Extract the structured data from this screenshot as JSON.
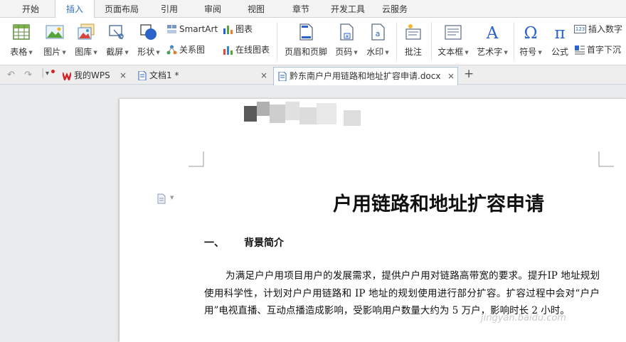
{
  "menu": {
    "items": [
      {
        "label": "开始"
      },
      {
        "label": "插入"
      },
      {
        "label": "页面布局"
      },
      {
        "label": "引用"
      },
      {
        "label": "审阅"
      },
      {
        "label": "视图"
      },
      {
        "label": "章节"
      },
      {
        "label": "开发工具"
      },
      {
        "label": "云服务"
      }
    ],
    "active": "插入"
  },
  "ribbon": {
    "table": "表格",
    "picture": "图片",
    "gallery": "图库",
    "screenshot": "截屏",
    "shape": "形状",
    "smartart": "SmartArt",
    "relation": "关系图",
    "chart": "图表",
    "online_chart": "在线图表",
    "header_footer": "页眉和页脚",
    "page_number": "页码",
    "watermark": "水印",
    "comment": "批注",
    "textbox": "文本框",
    "wordart": "艺术字",
    "symbol": "符号",
    "formula": "公式",
    "insert_number": "插入数字",
    "drop_cap": "首字下沉",
    "insert_number_badge": "123"
  },
  "tabs": [
    {
      "label": "我的WPS"
    },
    {
      "label": "文档1 *"
    },
    {
      "label": "黔东南户户用链路和地址扩容申请.docx"
    }
  ],
  "document": {
    "title_visible": "户用链路和地址扩容申请",
    "heading_number": "一、",
    "heading_text": "背景简介",
    "paragraph": "为满足户户用项目用户的发展需求，提供户户用对链路高带宽的要求。提升IP 地址规划使用科学性，计划对户户用链路和 IP 地址的规划使用进行部分扩容。扩容过程中会对“户户用”电视直播、互动点播造成影响，受影响用户数量大约为 5 万户，影响时长 2 小时。"
  },
  "watermark": "jingyan.baidu.com",
  "colors": {
    "accent": "#2f6fc0",
    "wps_red": "#d7201f",
    "doc_blue": "#2a62b8"
  }
}
